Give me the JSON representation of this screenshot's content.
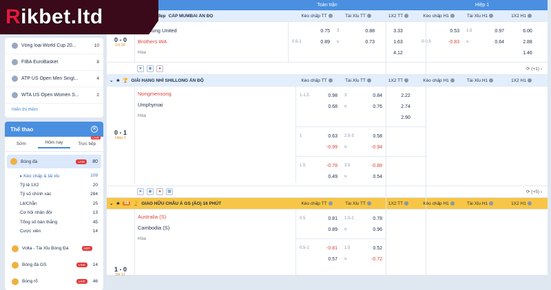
{
  "brand": {
    "r": "R",
    "rest": "ikbet.ltd"
  },
  "sidebar": {
    "leagues": [
      {
        "label": "Vòng loại World Cup 20...",
        "count": "10"
      },
      {
        "label": "FIBA EuroBasket",
        "count": "8"
      },
      {
        "label": "ATP US Open Men Singl...",
        "count": "4"
      },
      {
        "label": "WTA US Open Women S...",
        "count": "2"
      }
    ],
    "show_all": "Hiển thị thêm",
    "sports_title": "Thể thao",
    "tabs": {
      "early": "Sớm",
      "today": "Hôm nay",
      "live": "Trực tiếp",
      "live_badge": "LIVE"
    },
    "football": {
      "label": "Bóng đá",
      "live": "LIVE",
      "count": "80"
    },
    "subs": [
      {
        "label": "Kèo chấp & tài xỉu",
        "count": "109"
      },
      {
        "label": "Tỷ lệ 1X2",
        "count": "20"
      },
      {
        "label": "Tỷ số chính xác",
        "count": "284"
      },
      {
        "label": "Lẻ/Chẵn",
        "count": "25"
      },
      {
        "label": "Cơ hội nhân đôi",
        "count": "13"
      },
      {
        "label": "Tổng số bàn thắng",
        "count": "45"
      },
      {
        "label": "Cược xiên",
        "count": "14"
      }
    ],
    "sports": [
      {
        "label": "Volta - Tài Xỉu Bóng Đá",
        "badge": "HOT",
        "count": ""
      },
      {
        "label": "Bóng đá GS",
        "badge": "LIVE",
        "count": "14"
      },
      {
        "label": "Bóng rổ",
        "badge": "LIVE",
        "count": "46"
      }
    ]
  },
  "header": {
    "full_time": "Toàn trận",
    "half": "Hiệp 1"
  },
  "cols": {
    "hc": "Kèo chấp TT",
    "ou": "Tài Xỉu TT",
    "x12": "1X2 TT",
    "hc1": "Kèo chấp H1",
    "ou1": "Tài Xỉu H1",
    "x121": "1X2 H1"
  },
  "league1": {
    "name": "CẤP MUMBAI ẤN ĐỘ",
    "tag": "đẹp"
  },
  "match1": {
    "score": "0 - 0",
    "time": "1H 36'",
    "home": "Jagunung United",
    "away": "Brothers WA",
    "draw": "Hòa",
    "more": "(+1)"
  },
  "league2": {
    "name": "GIẢI HẠNG NHÌ SHILLONG ẤN ĐỘ"
  },
  "match2": {
    "score": "0 - 1",
    "time": "Hiệp 1",
    "home": "Nongmensong",
    "away": "Umphyrnai",
    "draw": "Hòa",
    "more": "(+5)"
  },
  "league3": {
    "name": "GIAO HỮU CHÂU Á GS (ẢO) 16 PHÚT",
    "tag": "SB"
  },
  "match3": {
    "home": "Australia (S)",
    "away": "Cambodia (S)",
    "draw": "Hòa",
    "score": "1 - 0",
    "time": "2H 11'"
  },
  "m1odds": {
    "r1": {
      "hc": "0.75",
      "ouh": "3",
      "ou": "0.88",
      "x12": "3.33",
      "hc1": "0.53",
      "ou1h": "1.5",
      "ou1": "0.97",
      "x121": "6.00"
    },
    "r2": {
      "hch": "0.5-1",
      "hc": "0.89",
      "ouh": "u",
      "ou": "0.73",
      "x12": "1.63",
      "hc1h": "0-0.5",
      "hc1": "-0.83",
      "ou1h": "u",
      "ou1": "0.64",
      "x121": "2.88"
    },
    "r3": {
      "x12": "4.12",
      "x121": "1.46"
    }
  },
  "m2odds": {
    "b1r1": {
      "hch": "1-1.5",
      "hc": "0.98",
      "ouh": "3",
      "ou": "0.84",
      "x12": "2.22"
    },
    "b1r2": {
      "hc": "0.68",
      "ouh": "u",
      "ou": "0.76",
      "x12": "2.74"
    },
    "b1r3": {
      "x12": "2.90"
    },
    "b2r1": {
      "hch": "1",
      "hc": "0.63",
      "ouh": "2.5-3",
      "ou": "0.58"
    },
    "b2r2": {
      "hc": "-0.99",
      "ouh": "u",
      "ou": "-0.94"
    },
    "b3r1": {
      "hch": "1.5",
      "hc": "-0.78",
      "ouh": "3.5",
      "ou": "-0.88"
    },
    "b3r2": {
      "hc": "0.49",
      "ouh": "u",
      "ou": "0.54"
    }
  },
  "m3odds": {
    "b1r1": {
      "hch": "0.5",
      "hc": "0.81",
      "ouh": "1.5-2",
      "ou": "0.78"
    },
    "b1r2": {
      "hc": "0.89",
      "ouh": "u",
      "ou": "0.96"
    },
    "b2r1": {
      "hch": "0.5-1",
      "hc": "-0.81",
      "ouh": "1.5",
      "ou": "0.52"
    },
    "b2r2": {
      "hc": "0.57",
      "ouh": "u",
      "ou": "-0.72"
    }
  }
}
